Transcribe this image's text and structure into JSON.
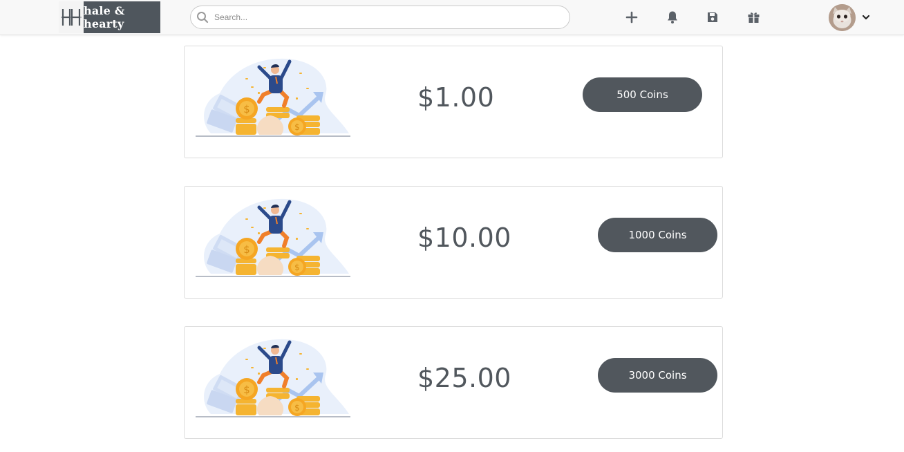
{
  "header": {
    "logo_text": "hale & hearty",
    "search_placeholder": "Search...",
    "icons": [
      "plus-icon",
      "bell-icon",
      "save-icon",
      "gift-icon"
    ]
  },
  "packages": [
    {
      "price": "$1.00",
      "button_label": "500 Coins"
    },
    {
      "price": "$10.00",
      "button_label": "1000 Coins"
    },
    {
      "price": "$25.00",
      "button_label": "3000 Coins"
    }
  ],
  "colors": {
    "button": "#51575d",
    "price_text": "#51575d",
    "coin": "#f5a623",
    "figure_shirt": "#2b4a8b",
    "figure_pants": "#f07f2a"
  }
}
